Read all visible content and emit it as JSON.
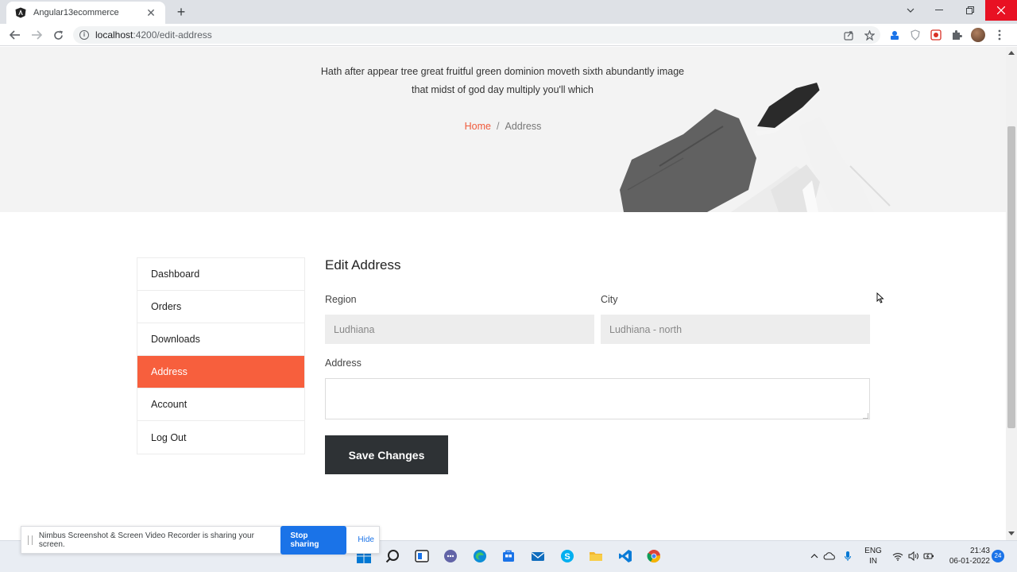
{
  "browser": {
    "tab_title": "Angular13ecommerce",
    "tab_close": "✕",
    "new_tab": "+",
    "url_host": "localhost",
    "url_path": ":4200/edit-address"
  },
  "hero": {
    "text": "Hath after appear tree great fruitful green dominion moveth sixth abundantly image that midst of god day multiply you'll which",
    "breadcrumb_home": "Home",
    "breadcrumb_sep": "/",
    "breadcrumb_current": "Address"
  },
  "sidebar": {
    "items": [
      {
        "label": "Dashboard"
      },
      {
        "label": "Orders"
      },
      {
        "label": "Downloads"
      },
      {
        "label": "Address"
      },
      {
        "label": "Account"
      },
      {
        "label": "Log Out"
      }
    ],
    "active_index": 3
  },
  "form": {
    "title": "Edit Address",
    "region_label": "Region",
    "region_value": "Ludhiana",
    "city_label": "City",
    "city_value": "Ludhiana - north",
    "address_label": "Address",
    "address_value": "",
    "save_label": "Save Changes"
  },
  "share_bar": {
    "message": "Nimbus Screenshot & Screen Video Recorder is sharing your screen.",
    "stop_label": "Stop sharing",
    "hide_label": "Hide"
  },
  "taskbar": {
    "lang_top": "ENG",
    "lang_bottom": "IN",
    "time": "21:43",
    "date": "06-01-2022",
    "notification_count": "24"
  },
  "colors": {
    "accent": "#f75f3d",
    "breadcrumb_home": "#f05a3b",
    "button_dark": "#2e3235",
    "hero_bg": "#f3f3f3",
    "field_bg": "#ededed"
  }
}
